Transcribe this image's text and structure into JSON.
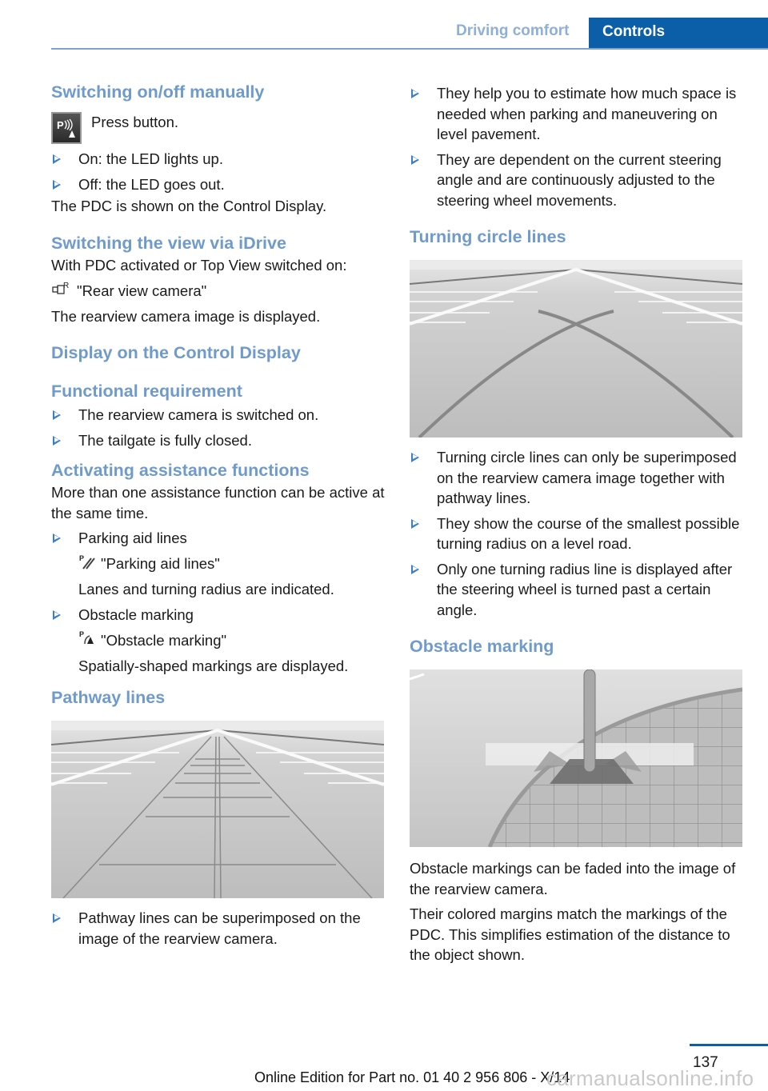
{
  "header": {
    "section": "Driving comfort",
    "chapter": "Controls"
  },
  "left": {
    "s1": {
      "title": "Switching on/off manually",
      "button_icon": "pdc-button-icon",
      "press": "Press button.",
      "bullets": [
        "On: the LED lights up.",
        "Off: the LED goes out."
      ],
      "note": "The PDC is shown on the Control Display."
    },
    "s2": {
      "title": "Switching the view via iDrive",
      "intro": "With PDC activated or Top View switched on:",
      "menu_icon": "rear-view-camera-icon",
      "menu_label": "\"Rear view camera\"",
      "result": "The rearview camera image is displayed."
    },
    "s3": {
      "title": "Display on the Control Display"
    },
    "s4": {
      "title": "Functional requirement",
      "bullets": [
        "The rearview camera is switched on.",
        "The tailgate is fully closed."
      ]
    },
    "s5": {
      "title": "Activating assistance functions",
      "intro": "More than one assistance function can be active at the same time.",
      "items": [
        {
          "label": "Parking aid lines",
          "icon": "parking-aid-lines-icon",
          "menu": "\"Parking aid lines\"",
          "desc": "Lanes and turning radius are indicated."
        },
        {
          "label": "Obstacle marking",
          "icon": "obstacle-marking-icon",
          "menu": "\"Obstacle marking\"",
          "desc": "Spatially-shaped markings are displayed."
        }
      ]
    },
    "s6": {
      "title": "Pathway lines",
      "figure": "pathway-lines-illustration",
      "bullets": [
        "Pathway lines can be superimposed on the image of the rearview camera."
      ]
    }
  },
  "right": {
    "top_bullets": [
      "They help you to estimate how much space is needed when parking and maneuvering on level pavement.",
      "They are dependent on the current steering angle and are continuously adjusted to the steering wheel movements."
    ],
    "s7": {
      "title": "Turning circle lines",
      "figure": "turning-circle-lines-illustration",
      "bullets": [
        "Turning circle lines can only be superimposed on the rearview camera image together with pathway lines.",
        "They show the course of the smallest possible turning radius on a level road.",
        "Only one turning radius line is displayed after the steering wheel is turned past a certain angle."
      ]
    },
    "s8": {
      "title": "Obstacle marking",
      "figure": "obstacle-marking-illustration",
      "p1": "Obstacle markings can be faded into the image of the rearview camera.",
      "p2": "Their colored margins match the markings of the PDC. This simplifies estimation of the distance to the object shown."
    }
  },
  "footer": {
    "page": "137",
    "edition": "Online Edition for Part no. 01 40 2 956 806 - X/14",
    "watermark": "carmanualsonline.info"
  },
  "colors": {
    "accent": "#0b5ea8",
    "heading": "#6f9bcc",
    "bullet": "#3b7fc4"
  }
}
